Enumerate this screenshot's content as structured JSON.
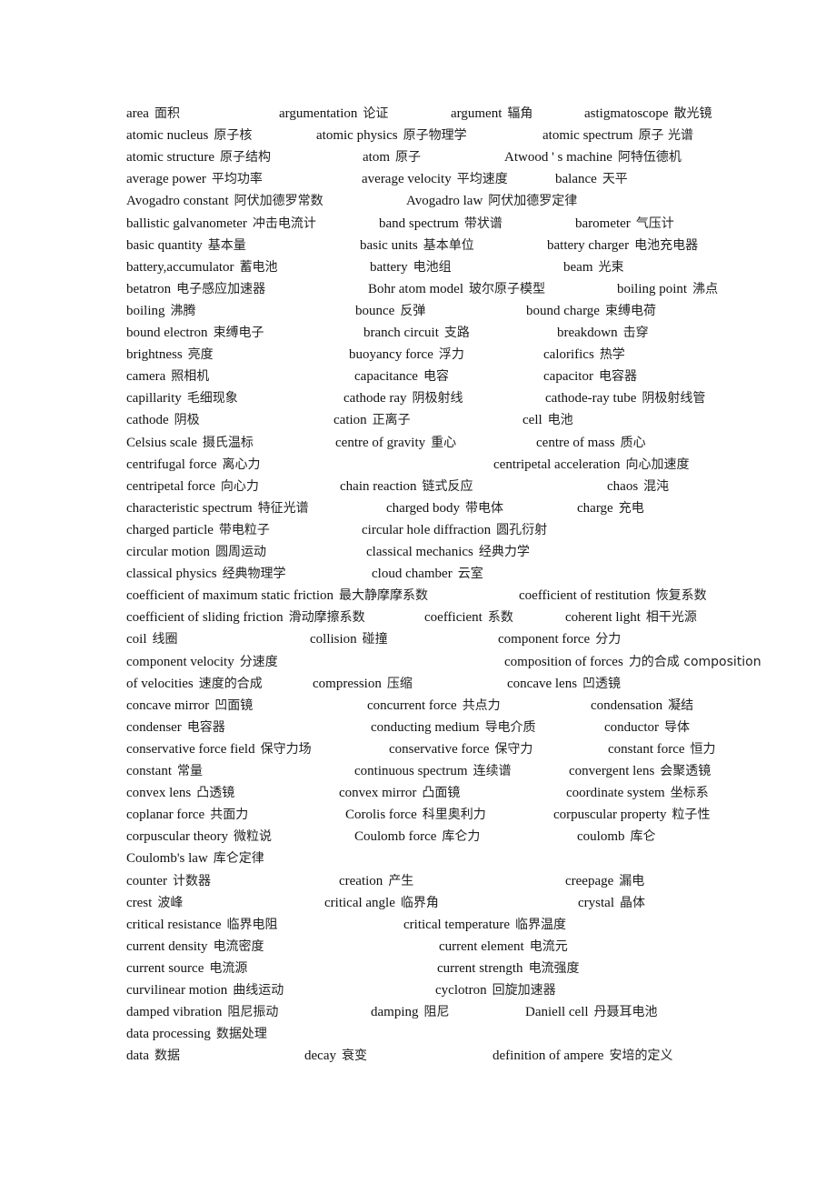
{
  "document": {
    "type": "physics glossary (English–Chinese)",
    "lines": [
      [
        {
          "en": "area",
          "zh": "面积"
        },
        {
          "en": "argumentation",
          "zh": "论证"
        },
        {
          "en": "argument",
          "zh": "辐角"
        },
        {
          "en": "astigmatoscope",
          "zh": "散光镜"
        }
      ],
      [
        {
          "en": "atomic nucleus",
          "zh": "原子核"
        },
        {
          "en": "atomic physics",
          "zh": "原子物理学"
        },
        {
          "en": "atomic spectrum",
          "zh": "原子 光谱"
        }
      ],
      [
        {
          "en": "atomic structure",
          "zh": "原子结构"
        },
        {
          "en": "atom",
          "zh": "原子"
        },
        {
          "en": "Atwood ' s machine",
          "zh": "阿特伍德机"
        }
      ],
      [
        {
          "en": "average power",
          "zh": "平均功率"
        },
        {
          "en": "average velocity",
          "zh": "平均速度"
        },
        {
          "en": "balance",
          "zh": "天平"
        }
      ],
      [
        {
          "en": "Avogadro constant",
          "zh": "阿伏加德罗常数"
        },
        {
          "en": "Avogadro law",
          "zh": "阿伏加德罗定律"
        }
      ],
      [
        {
          "en": "ballistic galvanometer",
          "zh": "冲击电流计"
        },
        {
          "en": "band spectrum",
          "zh": "带状谱"
        },
        {
          "en": "barometer",
          "zh": "气压计"
        }
      ],
      [
        {
          "en": "basic quantity",
          "zh": "基本量"
        },
        {
          "en": "basic units",
          "zh": "基本单位"
        },
        {
          "en": "battery charger",
          "zh": "电池充电器"
        }
      ],
      [
        {
          "en": "battery,accumulator",
          "zh": "蓄电池"
        },
        {
          "en": "battery",
          "zh": "电池组"
        },
        {
          "en": "beam",
          "zh": "光束"
        }
      ],
      [
        {
          "en": "betatron",
          "zh": "电子感应加速器"
        },
        {
          "en": "Bohr atom model",
          "zh": "玻尔原子模型"
        },
        {
          "en": "boiling point",
          "zh": "沸点"
        }
      ],
      [
        {
          "en": "boiling",
          "zh": "沸腾"
        },
        {
          "en": "bounce",
          "zh": "反弹"
        },
        {
          "en": "bound charge",
          "zh": "束缚电荷"
        }
      ],
      [
        {
          "en": "bound electron",
          "zh": "束缚电子"
        },
        {
          "en": "branch circuit",
          "zh": "支路"
        },
        {
          "en": "breakdown",
          "zh": "击穿"
        }
      ],
      [
        {
          "en": "brightness",
          "zh": "亮度"
        },
        {
          "en": "buoyancy force",
          "zh": "浮力"
        },
        {
          "en": "calorifics",
          "zh": "热学"
        }
      ],
      [
        {
          "en": "camera",
          "zh": "照相机"
        },
        {
          "en": "capacitance",
          "zh": "电容"
        },
        {
          "en": "capacitor",
          "zh": "电容器"
        }
      ],
      [
        {
          "en": "capillarity",
          "zh": "毛细现象"
        },
        {
          "en": "cathode ray",
          "zh": "阴极射线"
        },
        {
          "en": "cathode-ray tube",
          "zh": "阴极射线管"
        }
      ],
      [
        {
          "en": "cathode",
          "zh": "阴极"
        },
        {
          "en": "cation",
          "zh": "正离子"
        },
        {
          "en": "cell",
          "zh": "电池"
        }
      ],
      [
        {
          "en": "Celsius scale",
          "zh": "摄氏温标"
        },
        {
          "en": "centre of gravity",
          "zh": "重心"
        },
        {
          "en": "centre of mass",
          "zh": "质心"
        }
      ],
      [
        {
          "en": "centrifugal force",
          "zh": "离心力"
        },
        {
          "en": "centripetal acceleration",
          "zh": "向心加速度"
        }
      ],
      [
        {
          "en": "centripetal force",
          "zh": "向心力"
        },
        {
          "en": "chain reaction",
          "zh": "链式反应"
        },
        {
          "en": "chaos",
          "zh": "混沌"
        }
      ],
      [
        {
          "en": "characteristic spectrum",
          "zh": "特征光谱"
        },
        {
          "en": "charged body",
          "zh": "带电体"
        },
        {
          "en": "charge",
          "zh": "充电"
        }
      ],
      [
        {
          "en": "charged particle",
          "zh": "带电粒子"
        },
        {
          "en": "circular hole diffraction",
          "zh": "圆孔衍射"
        }
      ],
      [
        {
          "en": "circular motion",
          "zh": "圆周运动"
        },
        {
          "en": "classical mechanics",
          "zh": "经典力学"
        }
      ],
      [
        {
          "en": "classical physics",
          "zh": "经典物理学"
        },
        {
          "en": "cloud chamber",
          "zh": "云室"
        }
      ],
      [
        {
          "en": "coefficient of maximum static friction",
          "zh": "最大静摩摩系数"
        },
        {
          "en": "coefficient of restitution",
          "zh": "恢复系数"
        }
      ],
      [
        {
          "en": "coefficient of sliding friction",
          "zh": "滑动摩擦系数"
        },
        {
          "en": "coefficient",
          "zh": "系数"
        },
        {
          "en": "coherent light",
          "zh": "相干光源"
        }
      ],
      [
        {
          "en": "coil",
          "zh": "线圈"
        },
        {
          "en": "collision",
          "zh": "碰撞"
        },
        {
          "en": "component force",
          "zh": "分力"
        }
      ],
      [
        {
          "en": "component velocity",
          "zh": "分速度"
        },
        {
          "en": "composition of forces",
          "zh": "力的合成 composition"
        }
      ],
      [
        {
          "en": "of velocities",
          "zh": "速度的合成"
        },
        {
          "en": "compression",
          "zh": "压缩"
        },
        {
          "en": "concave lens",
          "zh": "凹透镜"
        }
      ],
      [
        {
          "en": "concave mirror",
          "zh": "凹面镜"
        },
        {
          "en": "concurrent force",
          "zh": "共点力"
        },
        {
          "en": "condensation",
          "zh": "凝结"
        }
      ],
      [
        {
          "en": "condenser",
          "zh": "电容器"
        },
        {
          "en": "conducting medium",
          "zh": "导电介质"
        },
        {
          "en": "conductor",
          "zh": "导体"
        }
      ],
      [
        {
          "en": "conservative force field",
          "zh": "保守力场"
        },
        {
          "en": "conservative force",
          "zh": "保守力"
        },
        {
          "en": "constant force",
          "zh": "恒力"
        }
      ],
      [
        {
          "en": "constant",
          "zh": "常量"
        },
        {
          "en": "continuous spectrum",
          "zh": "连续谱"
        },
        {
          "en": "convergent lens",
          "zh": "会聚透镜"
        }
      ],
      [
        {
          "en": "convex lens",
          "zh": "凸透镜"
        },
        {
          "en": "convex mirror",
          "zh": "凸面镜"
        },
        {
          "en": "coordinate system",
          "zh": "坐标系"
        }
      ],
      [
        {
          "en": "coplanar force",
          "zh": "共面力"
        },
        {
          "en": "Corolis force",
          "zh": "科里奥利力"
        },
        {
          "en": "corpuscular property",
          "zh": "粒子性"
        }
      ],
      [
        {
          "en": "corpuscular theory",
          "zh": "微粒说"
        },
        {
          "en": "Coulomb force",
          "zh": "库仑力"
        },
        {
          "en": "coulomb",
          "zh": "库仑"
        }
      ],
      [
        {
          "en": "Coulomb's law",
          "zh": "库仑定律"
        }
      ],
      [
        {
          "en": "counter",
          "zh": "计数器"
        },
        {
          "en": "creation",
          "zh": "产生"
        },
        {
          "en": "creepage",
          "zh": "漏电"
        }
      ],
      [
        {
          "en": "crest",
          "zh": "波峰"
        },
        {
          "en": "critical angle",
          "zh": "临界角"
        },
        {
          "en": "crystal",
          "zh": "晶体"
        }
      ],
      [
        {
          "en": "critical resistance",
          "zh": "临界电阻"
        },
        {
          "en": "critical temperature",
          "zh": "临界温度"
        }
      ],
      [
        {
          "en": "current density",
          "zh": "电流密度"
        },
        {
          "en": "current element",
          "zh": "电流元"
        }
      ],
      [
        {
          "en": "current source",
          "zh": "电流源"
        },
        {
          "en": "current strength",
          "zh": "电流强度"
        }
      ],
      [
        {
          "en": "curvilinear motion",
          "zh": "曲线运动"
        },
        {
          "en": "cyclotron",
          "zh": "回旋加速器"
        }
      ],
      [
        {
          "en": "damped vibration",
          "zh": "阻尼振动"
        },
        {
          "en": "damping",
          "zh": "阻尼"
        },
        {
          "en": "Daniell cell",
          "zh": "丹聂耳电池"
        }
      ],
      [
        {
          "en": "data processing",
          "zh": "数据处理"
        }
      ],
      [
        {
          "en": "data",
          "zh": "数据"
        },
        {
          "en": "decay",
          "zh": "衰变"
        },
        {
          "en": "definition of ampere",
          "zh": "安培的定义"
        }
      ]
    ]
  }
}
